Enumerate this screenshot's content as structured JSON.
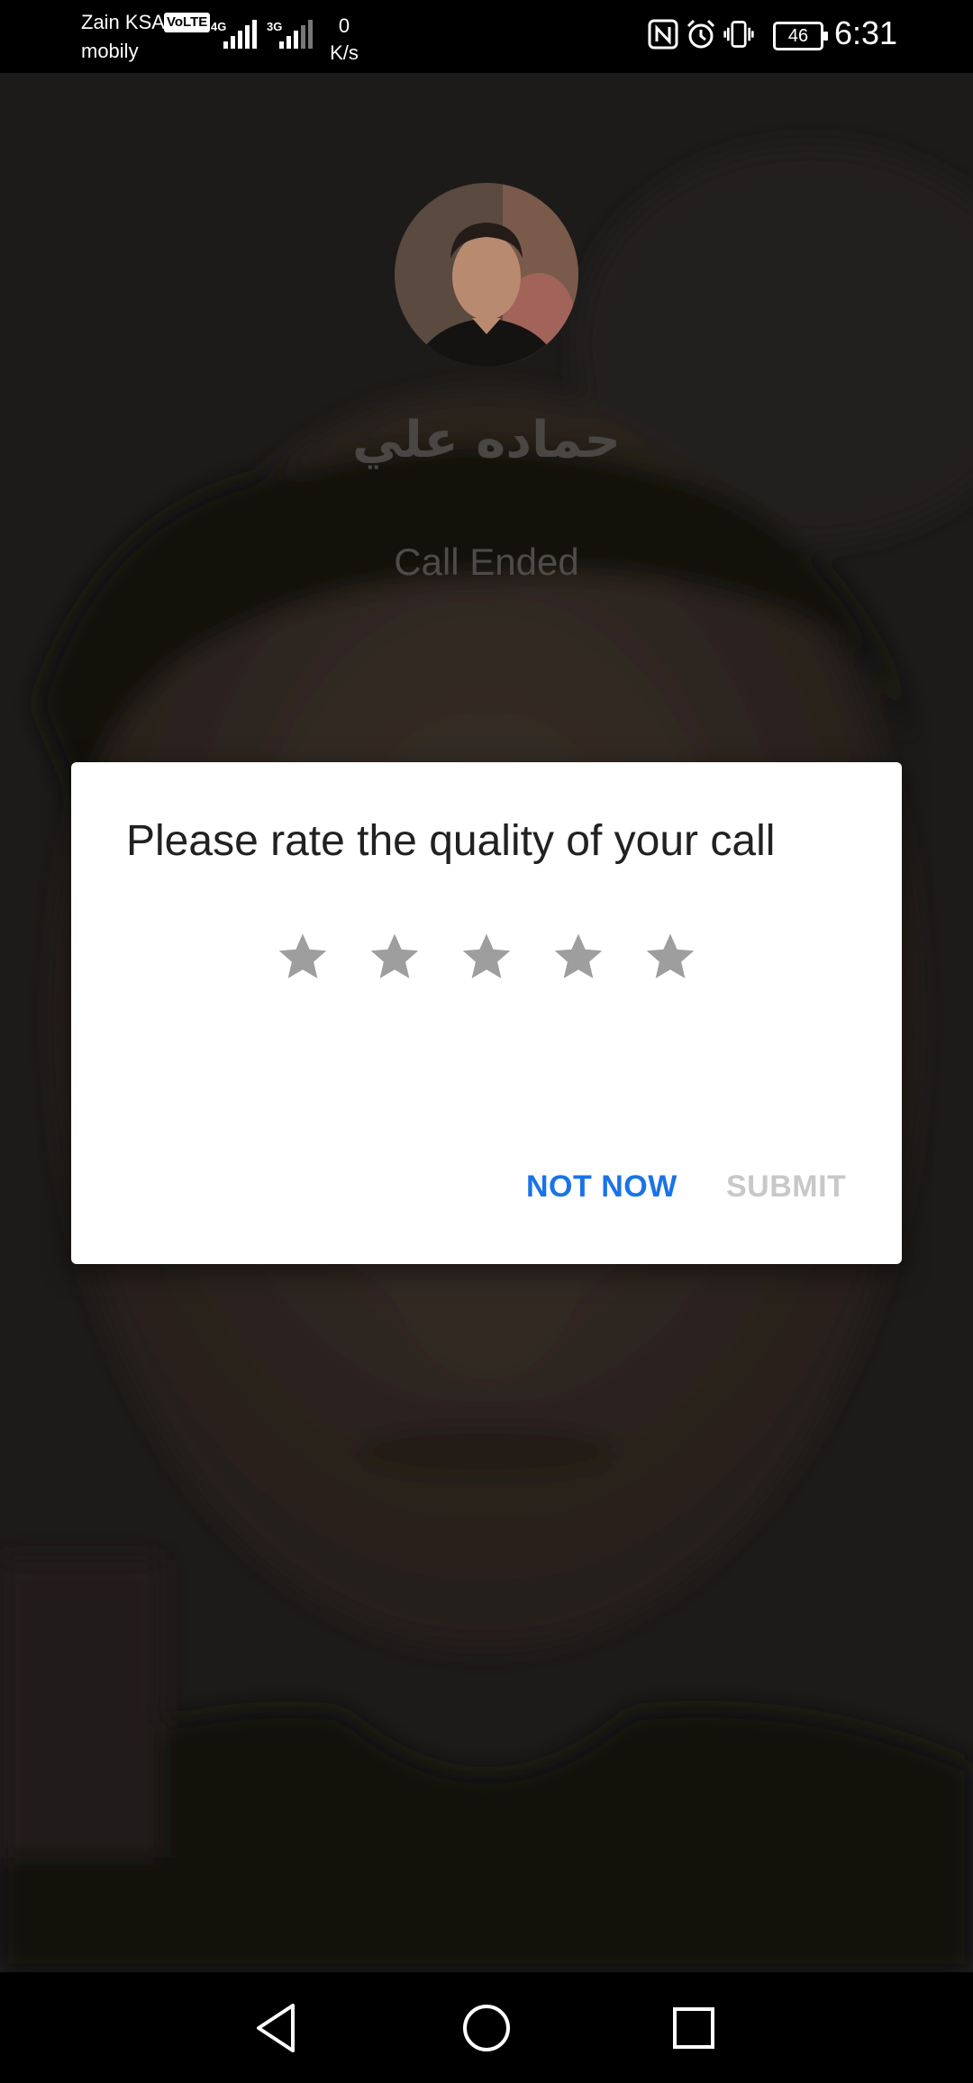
{
  "status_bar": {
    "carrier_1": "Zain KSA",
    "carrier_2": "mobily",
    "volte_badge": "VoLTE",
    "network_1": "4G",
    "network_2": "3G",
    "net_speed_value": "0",
    "net_speed_unit": "K/s",
    "battery_level": "46",
    "time": "6:31",
    "icons": [
      "nfc-icon",
      "alarm-icon",
      "vibrate-icon",
      "battery-icon"
    ]
  },
  "call": {
    "caller_name": "حماده علي",
    "status": "Call Ended"
  },
  "rating_dialog": {
    "title": "Please rate the quality of your call",
    "rating": {
      "value": 0,
      "max": 5
    },
    "not_now_label": "NOT NOW",
    "submit_label": "SUBMIT",
    "colors": {
      "accent": "#1a73e8",
      "disabled": "#c8c8c8",
      "star": "#9e9e9e"
    }
  },
  "nav_bar": {
    "buttons": [
      "back-icon",
      "home-icon",
      "recents-icon"
    ]
  }
}
